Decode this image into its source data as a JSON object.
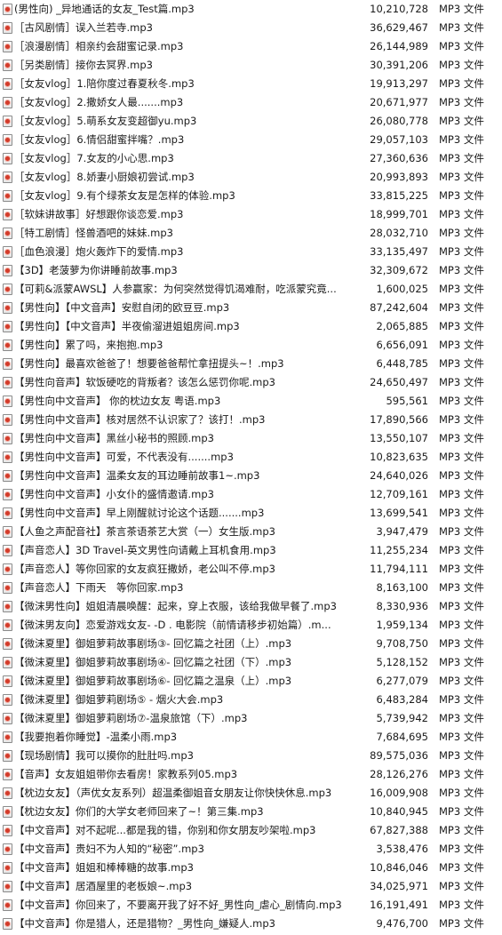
{
  "files": [
    {
      "name": "(男性向) _异地通话的女友_Test篇.mp3",
      "size": "10,210,728",
      "type": "MP3 文件"
    },
    {
      "name": "［古风剧情］误入兰若寺.mp3",
      "size": "36,629,467",
      "type": "MP3 文件"
    },
    {
      "name": "［浪漫剧情］相亲约会甜蜜记录.mp3",
      "size": "26,144,989",
      "type": "MP3 文件"
    },
    {
      "name": "［另类剧情］接你去冥界.mp3",
      "size": "30,391,206",
      "type": "MP3 文件"
    },
    {
      "name": "［女友vlog］1.陪你度过春夏秋冬.mp3",
      "size": "19,913,297",
      "type": "MP3 文件"
    },
    {
      "name": "［女友vlog］2.撒娇女人最.......mp3",
      "size": "20,671,977",
      "type": "MP3 文件"
    },
    {
      "name": "［女友vlog］5.萌系女友变超御yu.mp3",
      "size": "26,080,778",
      "type": "MP3 文件"
    },
    {
      "name": "［女友vlog］6.情侣甜蜜拌嘴？.mp3",
      "size": "29,057,103",
      "type": "MP3 文件"
    },
    {
      "name": "［女友vlog］7.女友的小心思.mp3",
      "size": "27,360,636",
      "type": "MP3 文件"
    },
    {
      "name": "［女友vlog］8.娇妻小厨娘初尝试.mp3",
      "size": "20,993,893",
      "type": "MP3 文件"
    },
    {
      "name": "［女友vlog］9.有个绿茶女友是怎样的体验.mp3",
      "size": "33,815,225",
      "type": "MP3 文件"
    },
    {
      "name": "［软妹讲故事］好想跟你谈恋爱.mp3",
      "size": "18,999,701",
      "type": "MP3 文件"
    },
    {
      "name": "［特工剧情］怪兽酒吧的妹妹.mp3",
      "size": "28,032,710",
      "type": "MP3 文件"
    },
    {
      "name": "［血色浪漫］炮火轰炸下的爱情.mp3",
      "size": "33,135,497",
      "type": "MP3 文件"
    },
    {
      "name": "【3D】老菠萝为你讲睡前故事.mp3",
      "size": "32,309,672",
      "type": "MP3 文件"
    },
    {
      "name": "【可莉&派蒙AWSL】人参赢家：为何突然觉得饥渴难耐，吃派蒙究竟...",
      "size": "1,600,025",
      "type": "MP3 文件"
    },
    {
      "name": "【男性向】【中文音声】安慰自闭的欧豆豆.mp3",
      "size": "87,242,604",
      "type": "MP3 文件"
    },
    {
      "name": "【男性向】【中文音声】半夜偷溜进姐姐房间.mp3",
      "size": "2,065,885",
      "type": "MP3 文件"
    },
    {
      "name": "【男性向】累了吗，来抱抱.mp3",
      "size": "6,656,091",
      "type": "MP3 文件"
    },
    {
      "name": "【男性向】最喜欢爸爸了！想要爸爸帮忙拿扭提头~！.mp3",
      "size": "6,448,785",
      "type": "MP3 文件"
    },
    {
      "name": "【男性向音声】软饭硬吃的背叛者？该怎么惩罚你呢.mp3",
      "size": "24,650,497",
      "type": "MP3 文件"
    },
    {
      "name": "【男性向中文音声】 你的枕边女友 粤语.mp3",
      "size": "595,561",
      "type": "MP3 文件"
    },
    {
      "name": "【男性向中文音声】核对居然不认识家了？该打！.mp3",
      "size": "17,890,566",
      "type": "MP3 文件"
    },
    {
      "name": "【男性向中文音声】黑丝小秘书的照顾.mp3",
      "size": "13,550,107",
      "type": "MP3 文件"
    },
    {
      "name": "【男性向中文音声】可爱，不代表没有.......mp3",
      "size": "10,823,635",
      "type": "MP3 文件"
    },
    {
      "name": "【男性向中文音声】温柔女友的耳边睡前故事1~.mp3",
      "size": "24,640,026",
      "type": "MP3 文件"
    },
    {
      "name": "【男性向中文音声】小女仆的盛情邀请.mp3",
      "size": "12,709,161",
      "type": "MP3 文件"
    },
    {
      "name": "【男性向中文音声】早上刚醒就讨论这个话题.......mp3",
      "size": "13,699,541",
      "type": "MP3 文件"
    },
    {
      "name": "【人鱼之声配音社】茶言茶语茶艺大赏（一）女生版.mp3",
      "size": "3,947,479",
      "type": "MP3 文件"
    },
    {
      "name": "【声音恋人】3D Travel-英文男性向请戴上耳机食用.mp3",
      "size": "11,255,234",
      "type": "MP3 文件"
    },
    {
      "name": "【声音恋人】等你回家的女友疯狂撒娇，老公叫不停.mp3",
      "size": "11,794,111",
      "type": "MP3 文件"
    },
    {
      "name": "【声音恋人】下雨天　等你回家.mp3",
      "size": "8,163,100",
      "type": "MP3 文件"
    },
    {
      "name": "【微沫男性向】姐姐清晨唤醒：起来，穿上衣服，该给我做早餐了.mp3",
      "size": "8,330,936",
      "type": "MP3 文件"
    },
    {
      "name": "【微沫男友向】恋爱游戏女友- -D . 电影院（前情请移步初始篇）.m...",
      "size": "1,959,134",
      "type": "MP3 文件"
    },
    {
      "name": "【微沫夏里】御姐萝莉故事剧场③- 回忆篇之社团（上）.mp3",
      "size": "9,708,750",
      "type": "MP3 文件"
    },
    {
      "name": "【微沫夏里】御姐萝莉故事剧场④- 回忆篇之社团（下）.mp3",
      "size": "5,128,152",
      "type": "MP3 文件"
    },
    {
      "name": "【微沫夏里】御姐萝莉故事剧场⑥- 回忆篇之温泉（上）.mp3",
      "size": "6,277,079",
      "type": "MP3 文件"
    },
    {
      "name": "【微沫夏里】御姐萝莉剧场⑤ - 烟火大会.mp3",
      "size": "6,483,284",
      "type": "MP3 文件"
    },
    {
      "name": "【微沫夏里】御姐萝莉剧场⑦-温泉旅馆（下）.mp3",
      "size": "5,739,942",
      "type": "MP3 文件"
    },
    {
      "name": "【我要抱着你睡觉】-温柔小雨.mp3",
      "size": "7,684,695",
      "type": "MP3 文件"
    },
    {
      "name": "【现场剧情】我可以摸你的肚肚吗.mp3",
      "size": "89,575,036",
      "type": "MP3 文件"
    },
    {
      "name": "【音声】女友姐姐带你去看房！家教系列05.mp3",
      "size": "28,126,276",
      "type": "MP3 文件"
    },
    {
      "name": "【枕边女友】（声优女友系列）超温柔御姐音女朋友让你快快休息.mp3",
      "size": "16,009,908",
      "type": "MP3 文件"
    },
    {
      "name": "【枕边女友】你们的大学女老师回来了~！第三集.mp3",
      "size": "10,840,945",
      "type": "MP3 文件"
    },
    {
      "name": "【中文音声】对不起呢...都是我的错，你别和你女朋友吵架啦.mp3",
      "size": "67,827,388",
      "type": "MP3 文件"
    },
    {
      "name": "【中文音声】贵妇不为人知的“秘密”.mp3",
      "size": "3,538,476",
      "type": "MP3 文件"
    },
    {
      "name": "【中文音声】姐姐和棒棒糖的故事.mp3",
      "size": "10,846,046",
      "type": "MP3 文件"
    },
    {
      "name": "【中文音声】居酒屋里的老板娘~.mp3",
      "size": "34,025,971",
      "type": "MP3 文件"
    },
    {
      "name": "【中文音声】你回来了，不要离开我了好不好_男性向_虐心_剧情向.mp3",
      "size": "16,191,491",
      "type": "MP3 文件"
    },
    {
      "name": "【中文音声】你是猎人，还是猎物？_男性向_嫌疑人.mp3",
      "size": "9,476,700",
      "type": "MP3 文件"
    }
  ]
}
